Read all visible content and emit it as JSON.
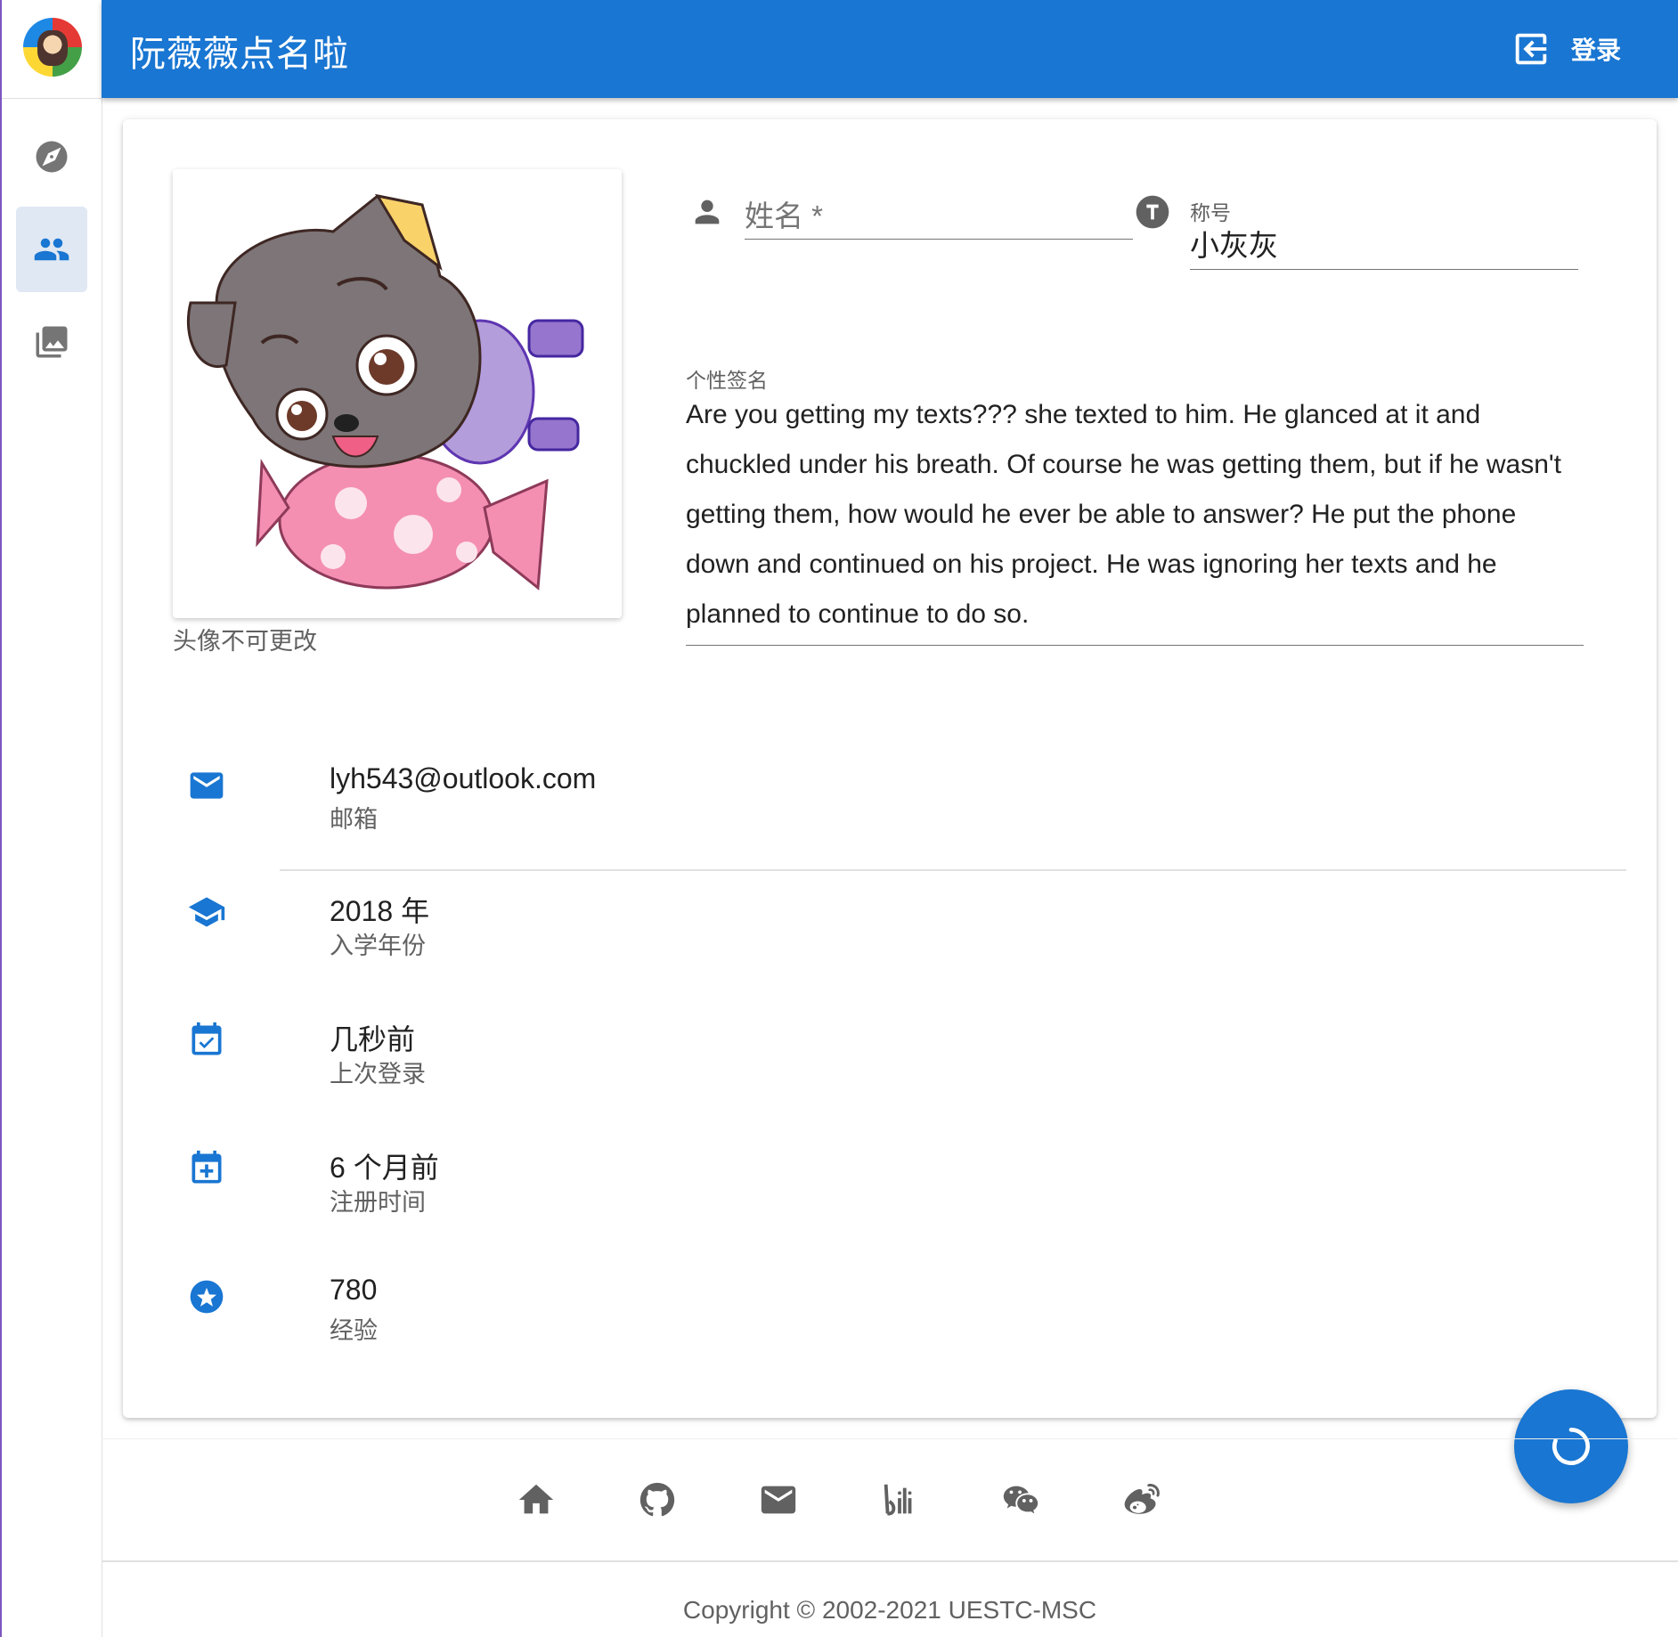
{
  "app": {
    "title": "阮薇薇点名啦",
    "login_label": "登录",
    "accent": "#1976d2"
  },
  "sidebar": {
    "items": [
      {
        "icon": "compass-icon",
        "active": false
      },
      {
        "icon": "people-icon",
        "active": true
      },
      {
        "icon": "photo-library-icon",
        "active": false
      }
    ]
  },
  "profile": {
    "avatar_note": "头像不可更改",
    "name": {
      "placeholder": "姓名 *",
      "value": ""
    },
    "title": {
      "label": "称号",
      "value": "小灰灰"
    },
    "signature": {
      "label": "个性签名",
      "value": "Are you getting my texts??? she texted to him. He glanced at it and chuckled under his breath. Of course he was getting them, but if he wasn't getting them, how would he ever be able to answer? He put the phone down and continued on his project. He was ignoring her texts and he planned to continue to do so."
    }
  },
  "info": [
    {
      "icon": "email-icon",
      "value": "lyh543@outlook.com",
      "label": "邮箱"
    },
    {
      "icon": "school-icon",
      "value": "2018 年",
      "label": "入学年份"
    },
    {
      "icon": "calendar-check-icon",
      "value": "几秒前",
      "label": "上次登录"
    },
    {
      "icon": "calendar-plus-icon",
      "value": "6 个月前",
      "label": "注册时间"
    },
    {
      "icon": "star-circle-icon",
      "value": "780",
      "label": "经验"
    }
  ],
  "footer": {
    "icons": [
      "home-icon",
      "github-icon",
      "email-icon",
      "bilibili-icon",
      "wechat-icon",
      "weibo-icon"
    ],
    "copyright": "Copyright © 2002-2021 UESTC-MSC"
  }
}
